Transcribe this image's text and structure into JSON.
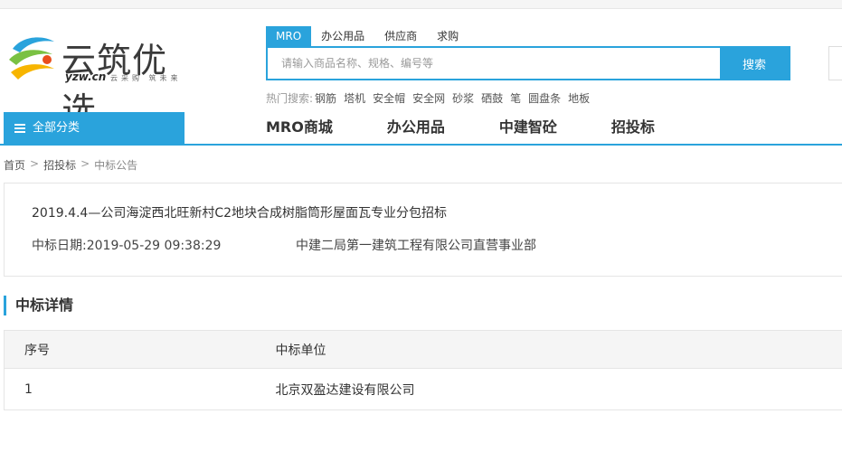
{
  "logo": {
    "name": "云筑优选",
    "domain": "yzw.cn",
    "slogan": "云采购 筑未来"
  },
  "search": {
    "tabs": [
      {
        "label": "MRO",
        "active": true
      },
      {
        "label": "办公用品",
        "active": false
      },
      {
        "label": "供应商",
        "active": false
      },
      {
        "label": "求购",
        "active": false
      }
    ],
    "placeholder": "请输入商品名称、规格、编号等",
    "button_label": "搜索",
    "hot_label": "热门搜索:",
    "hot_terms": [
      "钢筋",
      "塔机",
      "安全帽",
      "安全网",
      "砂浆",
      "硒鼓",
      "笔",
      "圆盘条",
      "地板"
    ]
  },
  "nav": {
    "all_categories": "全部分类",
    "links": [
      "MRO商城",
      "办公用品",
      "中建智砼",
      "招投标"
    ]
  },
  "breadcrumb": {
    "home": "首页",
    "level2": "招投标",
    "current": "中标公告",
    "separator": ">"
  },
  "notice": {
    "title": "2019.4.4—公司海淀西北旺新村C2地块合成树脂筒形屋面瓦专业分包招标",
    "date_label": "中标日期:",
    "date_value": "2019-05-29 09:38:29",
    "company": "中建二局第一建筑工程有限公司直营事业部"
  },
  "details": {
    "title": "中标详情",
    "columns": [
      "序号",
      "中标单位"
    ],
    "rows": [
      [
        "1",
        "北京双盈达建设有限公司"
      ]
    ]
  },
  "colors": {
    "accent": "#2aa3dc",
    "text": "#333333",
    "border": "#e5e5e5"
  }
}
